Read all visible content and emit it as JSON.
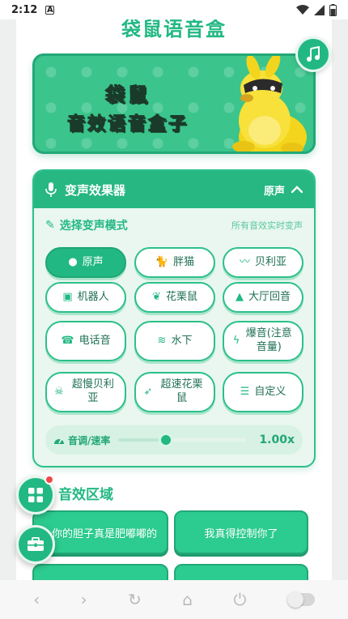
{
  "status_bar": {
    "time": "2:12",
    "notif_letter": "A"
  },
  "app": {
    "title": "袋鼠语音盒"
  },
  "banner": {
    "line1": "袋鼠",
    "line2": "音效语音盒子"
  },
  "voice_panel": {
    "title": "变声效果器",
    "current_mode": "原声",
    "section_label": "选择变声模式",
    "section_hint": "所有音效实时变声",
    "modes": [
      {
        "label": "原声",
        "icon": "person-icon",
        "active": true
      },
      {
        "label": "胖猫",
        "icon": "cat-icon",
        "active": false
      },
      {
        "label": "贝利亚",
        "icon": "dragon-icon",
        "active": false
      },
      {
        "label": "机器人",
        "icon": "robot-icon",
        "active": false
      },
      {
        "label": "花栗鼠",
        "icon": "squirrel-icon",
        "active": false
      },
      {
        "label": "大厅回音",
        "icon": "mountain-icon",
        "active": false
      },
      {
        "label": "电话音",
        "icon": "phone-icon",
        "active": false
      },
      {
        "label": "水下",
        "icon": "water-icon",
        "active": false
      },
      {
        "label": "爆音(注意音量)",
        "icon": "bolt-icon",
        "active": false
      },
      {
        "label": "超慢贝利亚",
        "icon": "skull-icon",
        "active": false
      },
      {
        "label": "超速花栗鼠",
        "icon": "rocket-icon",
        "active": false
      },
      {
        "label": "自定义",
        "icon": "sliders-icon",
        "active": false
      }
    ],
    "pitch": {
      "label": "音调/速率",
      "value_text": "1.00x",
      "level": 0.37
    }
  },
  "sound_area": {
    "title": "音效区域",
    "buttons": [
      "你的胆子真是肥嘟嘟的",
      "我真得控制你了",
      "",
      ""
    ]
  },
  "colors": {
    "accent": "#22b883",
    "accent_dark": "#1fa676",
    "badge": "#f04848"
  }
}
